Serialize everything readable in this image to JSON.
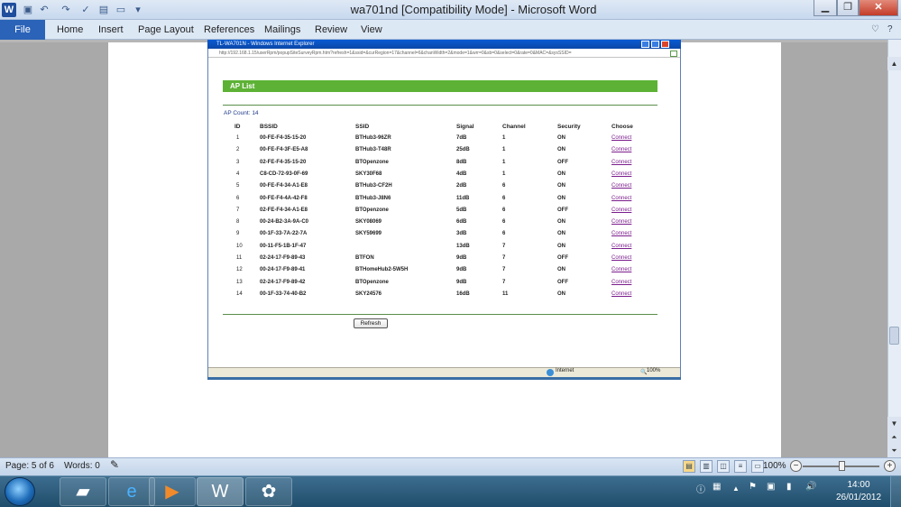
{
  "window": {
    "title": "wa701nd [Compatibility Mode]  -  Microsoft Word",
    "app_icon": "W"
  },
  "qat_icons": [
    "save-icon",
    "undo-icon",
    "redo-icon",
    "spell-check-icon",
    "print-preview-icon",
    "new-doc-icon",
    "customize-icon"
  ],
  "ribbon": {
    "file_label": "File",
    "tabs": [
      "Home",
      "Insert",
      "Page Layout",
      "References",
      "Mailings",
      "Review",
      "View"
    ]
  },
  "ie": {
    "title": "TL-WA701N - Windows Internet Explorer",
    "address": "http://192.168.1.15/userRpm/popupSiteSurveyRpm.htm?refresh=1&ssid=&curRegion=17&channel=6&chanWidth=2&mode=1&wrr=0&sb=0&select=0&rate=0&MAC=&sysSSID=",
    "status_zone": "Internet",
    "zoom": "100%"
  },
  "ap": {
    "heading": "AP List",
    "count_label": "AP Count: 14",
    "headers": {
      "id": "ID",
      "bssid": "BSSID",
      "ssid": "SSID",
      "signal": "Signal",
      "channel": "Channel",
      "security": "Security",
      "choose": "Choose"
    },
    "rows": [
      {
        "id": "1",
        "bssid": "00-FE-F4-35-15-20",
        "ssid": "BTHub3-96ZR",
        "signal": "7dB",
        "channel": "1",
        "security": "ON",
        "choose": "Connect"
      },
      {
        "id": "2",
        "bssid": "00-FE-F4-3F-E5-A8",
        "ssid": "BTHub3-T48R",
        "signal": "25dB",
        "channel": "1",
        "security": "ON",
        "choose": "Connect"
      },
      {
        "id": "3",
        "bssid": "02-FE-F4-35-15-20",
        "ssid": "BTOpenzone",
        "signal": "8dB",
        "channel": "1",
        "security": "OFF",
        "choose": "Connect"
      },
      {
        "id": "4",
        "bssid": "C8-CD-72-93-0F-69",
        "ssid": "SKY30F68",
        "signal": "4dB",
        "channel": "1",
        "security": "ON",
        "choose": "Connect"
      },
      {
        "id": "5",
        "bssid": "00-FE-F4-34-A1-E8",
        "ssid": "BTHub3-CF2H",
        "signal": "2dB",
        "channel": "6",
        "security": "ON",
        "choose": "Connect"
      },
      {
        "id": "6",
        "bssid": "00-FE-F4-4A-42-F8",
        "ssid": "BTHub3-J8N6",
        "signal": "11dB",
        "channel": "6",
        "security": "ON",
        "choose": "Connect"
      },
      {
        "id": "7",
        "bssid": "02-FE-F4-34-A1-E8",
        "ssid": "BTOpenzone",
        "signal": "5dB",
        "channel": "6",
        "security": "OFF",
        "choose": "Connect"
      },
      {
        "id": "8",
        "bssid": "00-24-B2-3A-9A-C0",
        "ssid": "SKY08069",
        "signal": "6dB",
        "channel": "6",
        "security": "ON",
        "choose": "Connect"
      },
      {
        "id": "9",
        "bssid": "00-1F-33-7A-22-7A",
        "ssid": "SKY59699",
        "signal": "3dB",
        "channel": "6",
        "security": "ON",
        "choose": "Connect"
      },
      {
        "id": "10",
        "bssid": "00-11-F5-1B-1F-47",
        "ssid": "",
        "signal": "13dB",
        "channel": "7",
        "security": "ON",
        "choose": "Connect"
      },
      {
        "id": "11",
        "bssid": "02-24-17-F9-89-43",
        "ssid": "BTFON",
        "signal": "9dB",
        "channel": "7",
        "security": "OFF",
        "choose": "Connect"
      },
      {
        "id": "12",
        "bssid": "00-24-17-F9-89-41",
        "ssid": "BTHomeHub2-5W5H",
        "signal": "9dB",
        "channel": "7",
        "security": "ON",
        "choose": "Connect"
      },
      {
        "id": "13",
        "bssid": "02-24-17-F9-89-42",
        "ssid": "BTOpenzone",
        "signal": "9dB",
        "channel": "7",
        "security": "OFF",
        "choose": "Connect"
      },
      {
        "id": "14",
        "bssid": "00-1F-33-74-40-B2",
        "ssid": "SKY24576",
        "signal": "16dB",
        "channel": "11",
        "security": "ON",
        "choose": "Connect"
      }
    ],
    "refresh_label": "Refresh"
  },
  "statusbar": {
    "page": "Page: 5 of 6",
    "words": "Words: 0",
    "zoom": "100%"
  },
  "taskbar": {
    "time": "14:00",
    "date": "26/01/2012"
  },
  "colors": {
    "ap_header": "#5db235",
    "link": "#7b1d8c",
    "file_tab": "#2a63b8"
  }
}
